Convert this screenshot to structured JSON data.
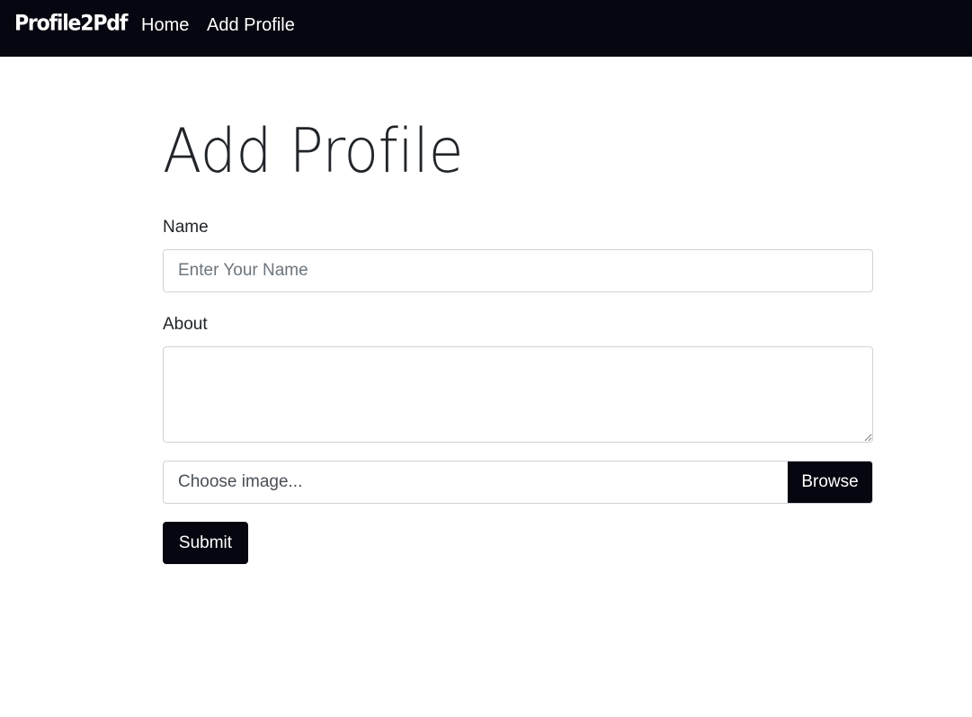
{
  "navbar": {
    "brand": "Profile2Pdf",
    "links": [
      {
        "label": "Home"
      },
      {
        "label": "Add Profile"
      }
    ],
    "background": "#05060f"
  },
  "main": {
    "title": "Add Profile",
    "form": {
      "name_label": "Name",
      "name_placeholder": "Enter Your Name",
      "name_value": "",
      "about_label": "About",
      "about_value": "",
      "file_placeholder": "Choose image...",
      "browse_label": "Browse",
      "submit_label": "Submit"
    }
  },
  "colors": {
    "primary_dark": "#05060f",
    "text": "#212529",
    "border": "#ced4da"
  }
}
